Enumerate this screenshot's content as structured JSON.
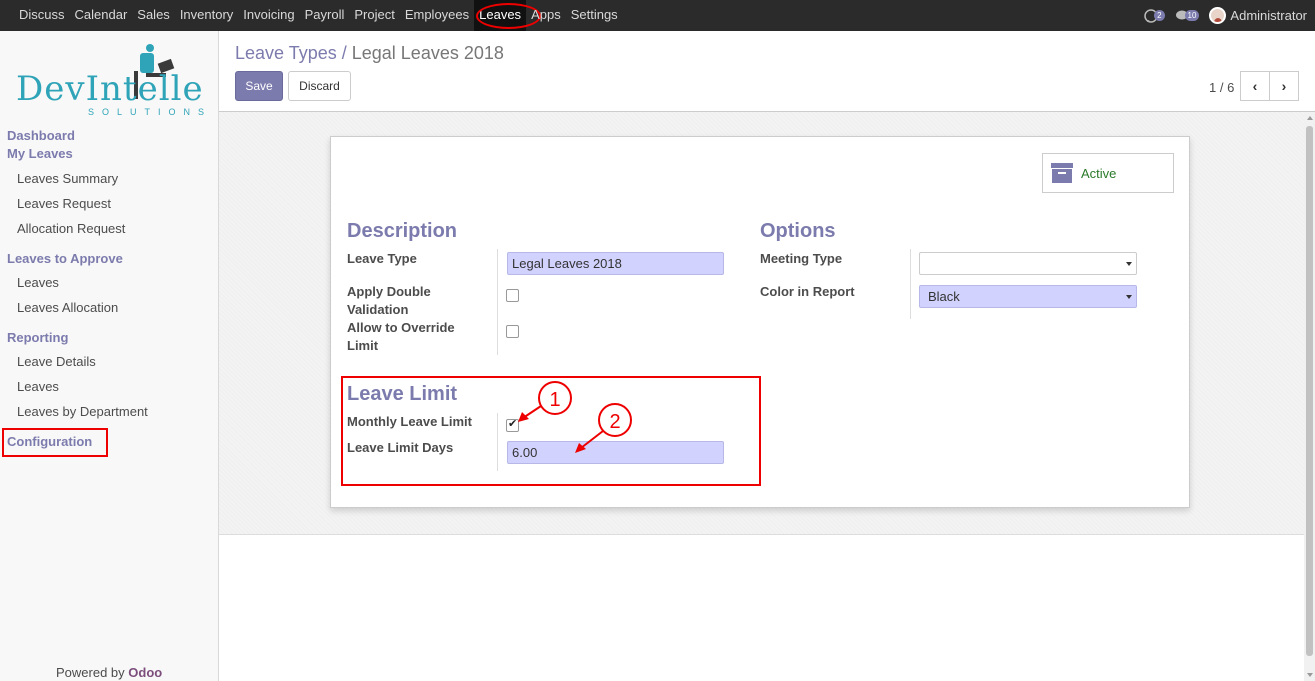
{
  "topbar": {
    "menu": [
      "Discuss",
      "Calendar",
      "Sales",
      "Inventory",
      "Invoicing",
      "Payroll",
      "Project",
      "Employees",
      "Leaves",
      "Apps",
      "Settings"
    ],
    "active": "Leaves",
    "chat_count": "2",
    "messages_count": "10",
    "user": "Administrator"
  },
  "logo": {
    "word": "DevIntelle",
    "tagline": "SOLUTIONS"
  },
  "sidebar": {
    "dashboard": "Dashboard",
    "my_leaves": "My Leaves",
    "my_leaves_items": [
      "Leaves Summary",
      "Leaves Request",
      "Allocation Request"
    ],
    "to_approve": "Leaves to Approve",
    "to_approve_items": [
      "Leaves",
      "Leaves Allocation"
    ],
    "reporting": "Reporting",
    "reporting_items": [
      "Leave Details",
      "Leaves",
      "Leaves by Department"
    ],
    "configuration": "Configuration",
    "powered_by": "Powered by",
    "powered_brand": "Odoo"
  },
  "control": {
    "breadcrumb_parent": "Leave Types /",
    "breadcrumb_current": "Legal Leaves 2018",
    "save": "Save",
    "discard": "Discard",
    "pager": "1 / 6",
    "prev": "‹",
    "next": "›"
  },
  "form": {
    "active_label": "Active",
    "description_title": "Description",
    "leave_type_label": "Leave Type",
    "leave_type_value": "Legal Leaves 2018",
    "double_validation_label": "Apply Double Validation",
    "override_limit_label": "Allow to Override Limit",
    "options_title": "Options",
    "meeting_type_label": "Meeting Type",
    "meeting_type_value": "",
    "color_label": "Color in Report",
    "color_value": "Black",
    "leave_limit_title": "Leave Limit",
    "monthly_limit_label": "Monthly Leave Limit",
    "monthly_limit_checked": true,
    "limit_days_label": "Leave Limit Days",
    "limit_days_value": "6.00"
  },
  "annotations": {
    "one": "1",
    "two": "2"
  },
  "colors": {
    "accent": "#7c7bad",
    "highlight": "#e00000",
    "active_green": "#2a7a2a"
  }
}
